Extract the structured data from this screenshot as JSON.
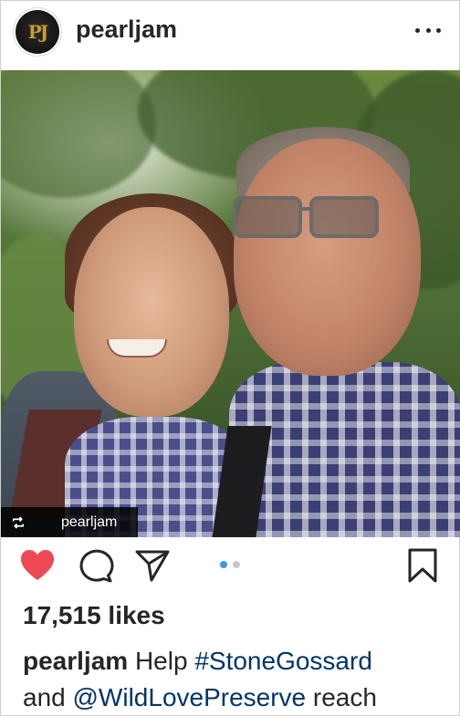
{
  "post": {
    "username": "pearljam",
    "avatar_text": "PJ",
    "more_icon": "ellipsis-horizontal-icon",
    "repost": {
      "icon": "repost-icon",
      "username": "pearljam"
    },
    "carousel": {
      "current": 1,
      "total": 2
    },
    "likes": "17,515 likes",
    "caption": {
      "username": "pearljam",
      "text_1": " Help ",
      "hashtag": "#StoneGossard",
      "text_2": "and ",
      "mention": "@WildLovePreserve",
      "text_3": " reach"
    },
    "colors": {
      "like": "#ed4956",
      "active_dot": "#3897f0",
      "link": "#003569"
    }
  }
}
